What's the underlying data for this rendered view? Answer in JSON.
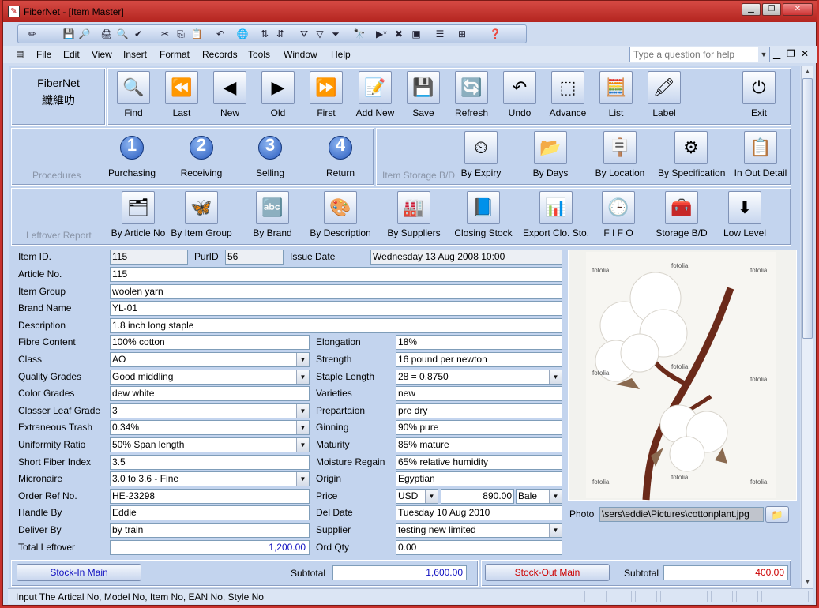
{
  "window": {
    "title": "FiberNet - [Item Master]",
    "app_icon": "document-icon"
  },
  "menu": [
    "File",
    "Edit",
    "View",
    "Insert",
    "Format",
    "Records",
    "Tools",
    "Window",
    "Help"
  ],
  "help_placeholder": "Type a question for help",
  "brand": {
    "name": "FiberNet",
    "sub": "纖維叻"
  },
  "nav_buttons": [
    {
      "label": "Find",
      "icon": "magnifier-icon",
      "glyph": "🔍"
    },
    {
      "label": "Last",
      "icon": "rewind-icon",
      "glyph": "⏪"
    },
    {
      "label": "New",
      "icon": "arrow-left-icon",
      "glyph": "◀"
    },
    {
      "label": "Old",
      "icon": "arrow-right-icon",
      "glyph": "▶"
    },
    {
      "label": "First",
      "icon": "fast-forward-icon",
      "glyph": "⏩"
    },
    {
      "label": "Add New",
      "icon": "add-document-icon",
      "glyph": "📝"
    },
    {
      "label": "Save",
      "icon": "floppy-icon",
      "glyph": "💾"
    },
    {
      "label": "Refresh",
      "icon": "refresh-icon",
      "glyph": "🔄"
    },
    {
      "label": "Undo",
      "icon": "undo-icon",
      "glyph": "↶"
    },
    {
      "label": "Advance",
      "icon": "frame-icon",
      "glyph": "⬚"
    },
    {
      "label": "List",
      "icon": "calculator-icon",
      "glyph": "🧮"
    },
    {
      "label": "Label",
      "icon": "marker-icon",
      "glyph": "🖍"
    },
    {
      "label": "Exit",
      "icon": "power-icon",
      "glyph": "⏻"
    }
  ],
  "procedures": {
    "caption": "Procedures",
    "buttons": [
      {
        "label": "Purchasing",
        "num": "1"
      },
      {
        "label": "Receiving",
        "num": "2"
      },
      {
        "label": "Selling",
        "num": "3"
      },
      {
        "label": "Return",
        "num": "4"
      }
    ]
  },
  "storage": {
    "caption": "Item Storage B/D",
    "buttons": [
      {
        "label": "By Expiry",
        "icon": "clock-icon",
        "glyph": "⏲"
      },
      {
        "label": "By Days",
        "icon": "folder-icon",
        "glyph": "📂"
      },
      {
        "label": "By Location",
        "icon": "signpost-icon",
        "glyph": "🪧"
      },
      {
        "label": "By Specification",
        "icon": "gears-icon",
        "glyph": "⚙"
      },
      {
        "label": "In Out Detail",
        "icon": "report-icon",
        "glyph": "📋"
      }
    ]
  },
  "leftover": {
    "caption": "Leftover Report",
    "buttons": [
      {
        "label": "By Article No",
        "icon": "folder-check-icon",
        "glyph": "🗂"
      },
      {
        "label": "By Item Group",
        "icon": "butterfly-icon",
        "glyph": "🦋"
      },
      {
        "label": "By Brand",
        "icon": "text-ab-icon",
        "glyph": "🔤"
      },
      {
        "label": "By Description",
        "icon": "palette-icon",
        "glyph": "🎨"
      },
      {
        "label": "By Suppliers",
        "icon": "factory-icon",
        "glyph": "🏭"
      },
      {
        "label": "Closing Stock",
        "icon": "book-icon",
        "glyph": "📘"
      },
      {
        "label": "Export Clo. Sto.",
        "icon": "excel-icon",
        "glyph": "📊"
      },
      {
        "label": "F I F O",
        "icon": "schedule-icon",
        "glyph": "🕒"
      },
      {
        "label": "Storage B/D",
        "icon": "safe-icon",
        "glyph": "🧰"
      },
      {
        "label": "Low Level",
        "icon": "arrow-down-icon",
        "glyph": "⬇"
      }
    ]
  },
  "form": {
    "item_id_label": "Item ID.",
    "item_id": "115",
    "purid_label": "PurID",
    "purid": "56",
    "issue_label": "Issue Date",
    "issue_date": "Wednesday 13 Aug 2008 10:00",
    "left": [
      {
        "label": "Article No.",
        "value": "115"
      },
      {
        "label": "Item Group",
        "value": "woolen yarn"
      },
      {
        "label": "Brand Name",
        "value": "YL-01"
      },
      {
        "label": "Description",
        "value": "1.8 inch long staple"
      },
      {
        "label": "Fibre Content",
        "value": "100% cotton"
      },
      {
        "label": "Class",
        "value": "AO"
      },
      {
        "label": "Quality Grades",
        "value": "Good middling"
      },
      {
        "label": "Color Grades",
        "value": "dew white"
      },
      {
        "label": "Classer Leaf Grade",
        "value": "3"
      },
      {
        "label": "Extraneous Trash",
        "value": "0.34%"
      },
      {
        "label": "Uniformity Ratio",
        "value": "50% Span length"
      },
      {
        "label": "Short Fiber Index",
        "value": "3.5"
      },
      {
        "label": "Micronaire",
        "value": "3.0 to 3.6  -  Fine"
      },
      {
        "label": "Order Ref No.",
        "value": "HE-23298"
      },
      {
        "label": "Handle By",
        "value": "Eddie"
      },
      {
        "label": "Deliver By",
        "value": "by train"
      },
      {
        "label": "Total Leftover",
        "value": "1,200.00"
      }
    ],
    "right": [
      {
        "label": "Elongation",
        "value": "18%"
      },
      {
        "label": "Strength",
        "value": "16 pound per newton"
      },
      {
        "label": "Staple Length",
        "value": "28  =  0.8750"
      },
      {
        "label": "Varieties",
        "value": "new"
      },
      {
        "label": "Prepartaion",
        "value": "pre dry"
      },
      {
        "label": "Ginning",
        "value": "90% pure"
      },
      {
        "label": "Maturity",
        "value": "85% mature"
      },
      {
        "label": "Moisture Regain",
        "value": "65% relative humidity"
      },
      {
        "label": "Origin",
        "value": "Egyptian"
      },
      {
        "label": "Price",
        "currency": "USD",
        "amount": "890.00",
        "unit": "Bale"
      },
      {
        "label": "Del Date",
        "value": "Tuesday 10 Aug 2010"
      },
      {
        "label": "Supplier",
        "value": "testing new limited"
      },
      {
        "label": "Ord Qty",
        "value": "0.00"
      }
    ],
    "photo_label": "Photo",
    "photo_path": "\\sers\\eddie\\Pictures\\cottonplant.jpg",
    "watermark": "fotolia"
  },
  "bottom": {
    "stock_in": "Stock-In Main",
    "stock_out": "Stock-Out Main",
    "subtotal_label": "Subtotal",
    "subtotal_in": "1,600.00",
    "subtotal_out": "400.00"
  },
  "status": "Input The Artical No, Model No, Item No,  EAN No, Style No",
  "colors": {
    "title": "#c8302b",
    "accent": "#1010c0",
    "red_text": "#cc0000"
  }
}
